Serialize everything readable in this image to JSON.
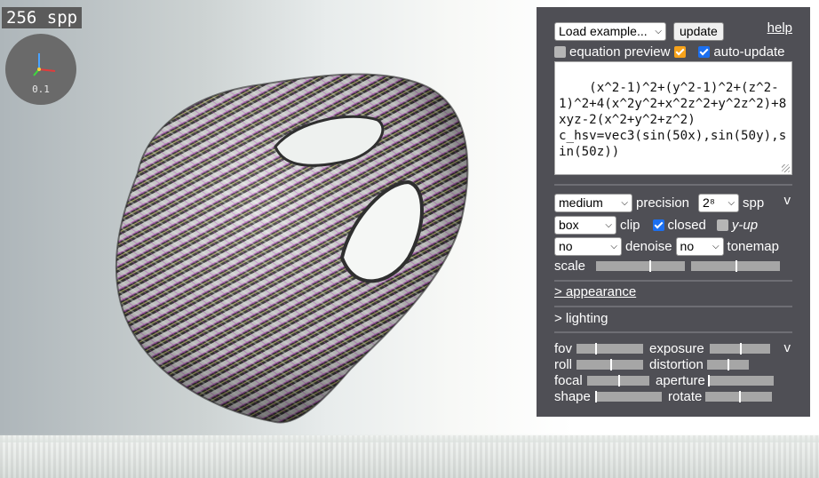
{
  "viewport": {
    "spp_badge": "256 spp",
    "gizmo_scale": "0.1"
  },
  "panel": {
    "example_select": "Load example...",
    "update_button": "update",
    "help_link": "help",
    "equation_preview_label": "equation preview",
    "equation_preview_checked": false,
    "preview_toggle_checked": true,
    "auto_update_label": "auto-update",
    "auto_update_checked": true,
    "equation_text": "(x^2-1)^2+(y^2-1)^2+(z^2-1)^2+4(x^2y^2+x^2z^2+y^2z^2)+8xyz-2(x^2+y^2+z^2)\nc_hsv=vec3(sin(50x),sin(50y),sin(50z))",
    "precision_select": "medium",
    "precision_label": "precision",
    "spp_select": "2⁸",
    "spp_label": "spp",
    "collapse_v": "v",
    "clip_select": "box",
    "clip_label": "clip",
    "closed_label": "closed",
    "closed_checked": true,
    "yup_label": "y-up",
    "yup_checked": false,
    "denoise_select": "no",
    "denoise_label": "denoise",
    "tonemap_select": "no",
    "tonemap_label": "tonemap",
    "scale_label": "scale",
    "scale_sliders": [
      0.6,
      0.5
    ],
    "appearance_link": "> appearance",
    "lighting_link": "> lighting",
    "camera": {
      "fov_label": "fov",
      "fov_value": 0.28,
      "exposure_label": "exposure",
      "exposure_value": 0.5,
      "collapse_v": "v",
      "roll_label": "roll",
      "roll_value": 0.5,
      "distortion_label": "distortion",
      "distortion_value": 0.5,
      "focal_label": "focal",
      "focal_value": 0.5,
      "aperture_label": "aperture",
      "aperture_value": 0.0,
      "shape_label": "shape",
      "shape_value": 0.0,
      "rotate_label": "rotate",
      "rotate_value": 0.5
    }
  },
  "colors": {
    "panel_bg": "#4f4f55",
    "checkbox_blue": "#1b6ff0",
    "checkbox_orange": "#f6a21a"
  }
}
